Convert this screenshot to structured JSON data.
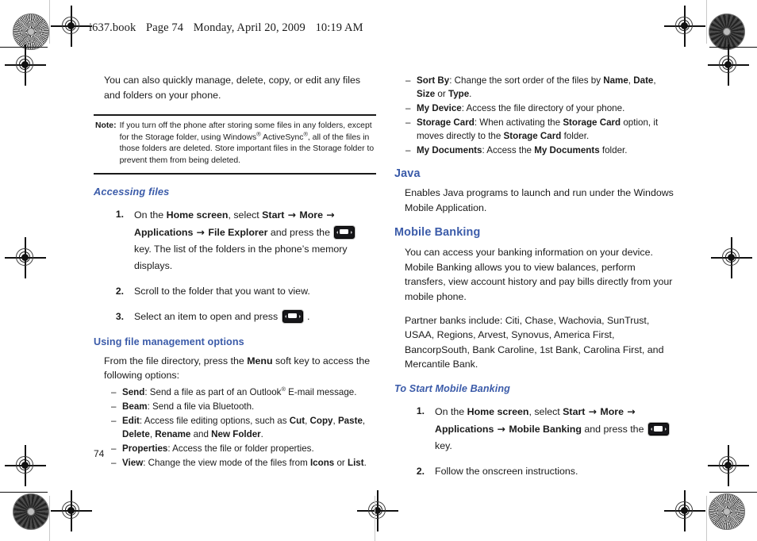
{
  "document": {
    "running_header": [
      "i637.book",
      "Page 74",
      "Monday, April 20, 2009",
      "10:19 AM"
    ],
    "page_number": "74",
    "accent_color": "#3b5ba9",
    "text_color": "#1a1a1a"
  },
  "left_column": {
    "intro": "You can also quickly manage, delete, copy, or edit any files and folders on your phone.",
    "note": {
      "label": "Note:",
      "text_parts": [
        "If you turn off the phone after storing some files in any folders, except for the Storage folder, using Windows",
        "® ",
        "ActiveSync",
        "®",
        ", all of the files in those folders are deleted. Store important files in the Storage folder to prevent them from being deleted."
      ]
    },
    "accessing_files": {
      "heading": "Accessing files",
      "steps": [
        {
          "num": "1.",
          "parts": [
            {
              "t": "On the ",
              "b": false
            },
            {
              "t": "Home screen",
              "b": true
            },
            {
              "t": ", select ",
              "b": false
            },
            {
              "t": "Start",
              "b": true
            },
            {
              "t": " → ",
              "b": false,
              "arrow": true
            },
            {
              "t": "More",
              "b": true
            },
            {
              "t": " → ",
              "b": false,
              "arrow": true
            },
            {
              "t": "Applications",
              "b": true
            },
            {
              "t": " → ",
              "b": false,
              "arrow": true
            },
            {
              "t": "File Explorer",
              "b": true
            },
            {
              "t": " and press the ",
              "b": false
            },
            {
              "t": "[KEY]",
              "b": false,
              "icon": "select-key-icon"
            },
            {
              "t": " key. The list of the folders in the phone’s memory displays.",
              "b": false
            }
          ]
        },
        {
          "num": "2.",
          "parts": [
            {
              "t": "Scroll to the folder that you want to view.",
              "b": false
            }
          ]
        },
        {
          "num": "3.",
          "parts": [
            {
              "t": "Select an item to open and press ",
              "b": false
            },
            {
              "t": "[KEY]",
              "b": false,
              "icon": "select-key-icon"
            },
            {
              "t": " .",
              "b": false
            }
          ]
        }
      ]
    },
    "file_management": {
      "heading": "Using file management options",
      "intro_parts": [
        {
          "t": "From the file directory, press the ",
          "b": false
        },
        {
          "t": "Menu",
          "b": true
        },
        {
          "t": " soft key to access the following options:",
          "b": false
        }
      ],
      "options": [
        {
          "term": "Send",
          "parts": [
            {
              "t": ": Send a file as part of an Outlook",
              "b": false
            },
            {
              "t": "®",
              "b": false,
              "sup": true
            },
            {
              "t": " E-mail message.",
              "b": false
            }
          ]
        },
        {
          "term": "Beam",
          "parts": [
            {
              "t": ": Send a file via Bluetooth.",
              "b": false
            }
          ]
        },
        {
          "term": "Edit",
          "parts": [
            {
              "t": ": Access file editing options, such as ",
              "b": false
            },
            {
              "t": "Cut",
              "b": true
            },
            {
              "t": ", ",
              "b": false
            },
            {
              "t": "Copy",
              "b": true
            },
            {
              "t": ", ",
              "b": false
            },
            {
              "t": "Paste",
              "b": true
            },
            {
              "t": ", ",
              "b": false
            },
            {
              "t": "Delete",
              "b": true
            },
            {
              "t": ", ",
              "b": false
            },
            {
              "t": "Rename",
              "b": true
            },
            {
              "t": " and ",
              "b": false
            },
            {
              "t": "New Folder",
              "b": true
            },
            {
              "t": ".",
              "b": false
            }
          ]
        },
        {
          "term": "Properties",
          "parts": [
            {
              "t": ": Access the file or folder properties.",
              "b": false
            }
          ]
        },
        {
          "term": "View",
          "parts": [
            {
              "t": ": Change the view mode of the files from ",
              "b": false
            },
            {
              "t": "Icons",
              "b": true
            },
            {
              "t": " or ",
              "b": false
            },
            {
              "t": "List",
              "b": true
            },
            {
              "t": ".",
              "b": false
            }
          ]
        }
      ]
    }
  },
  "right_column": {
    "options_continued": [
      {
        "term": "Sort By",
        "parts": [
          {
            "t": ": Change the sort order of the files by ",
            "b": false
          },
          {
            "t": "Name",
            "b": true
          },
          {
            "t": ", ",
            "b": false
          },
          {
            "t": "Date",
            "b": true
          },
          {
            "t": ", ",
            "b": false
          },
          {
            "t": "Size",
            "b": true
          },
          {
            "t": " or ",
            "b": false
          },
          {
            "t": "Type",
            "b": true
          },
          {
            "t": ".",
            "b": false
          }
        ]
      },
      {
        "term": "My Device",
        "parts": [
          {
            "t": ": Access the file directory of your phone.",
            "b": false
          }
        ]
      },
      {
        "term": "Storage Card",
        "parts": [
          {
            "t": ": When activating the ",
            "b": false
          },
          {
            "t": "Storage Card",
            "b": true
          },
          {
            "t": " option, it moves directly to the ",
            "b": false
          },
          {
            "t": "Storage Card",
            "b": true
          },
          {
            "t": " folder.",
            "b": false
          }
        ]
      },
      {
        "term": "My Documents",
        "parts": [
          {
            "t": ": Access the ",
            "b": false
          },
          {
            "t": "My Documents",
            "b": true
          },
          {
            "t": " folder.",
            "b": false
          }
        ]
      }
    ],
    "java": {
      "heading": "Java",
      "body": "Enables Java programs to launch and run under the Windows Mobile Application."
    },
    "mobile_banking": {
      "heading": "Mobile Banking",
      "paragraph1": "You can access your banking information on your device. Mobile Banking allows you to view balances, perform transfers, view account history and pay bills directly from your mobile phone.",
      "paragraph2": "Partner banks include: Citi, Chase, Wachovia, SunTrust, USAA, Regions, Arvest, Synovus, America First, BancorpSouth, Bank Caroline, 1st Bank, Carolina First, and Mercantile Bank.",
      "subheading": "To Start Mobile Banking",
      "steps": [
        {
          "num": "1.",
          "parts": [
            {
              "t": "On the ",
              "b": false
            },
            {
              "t": "Home screen",
              "b": true
            },
            {
              "t": ", select ",
              "b": false
            },
            {
              "t": "Start",
              "b": true
            },
            {
              "t": " → ",
              "b": false,
              "arrow": true
            },
            {
              "t": "More",
              "b": true
            },
            {
              "t": " → ",
              "b": false,
              "arrow": true
            },
            {
              "t": "Applications",
              "b": true
            },
            {
              "t": " → ",
              "b": false,
              "arrow": true
            },
            {
              "t": "Mobile Banking",
              "b": true
            },
            {
              "t": " and press the ",
              "b": false
            },
            {
              "t": "[KEY]",
              "b": false,
              "icon": "select-key-icon"
            },
            {
              "t": " key.",
              "b": false
            }
          ]
        },
        {
          "num": "2.",
          "parts": [
            {
              "t": "Follow the onscreen instructions.",
              "b": false
            }
          ]
        }
      ]
    }
  }
}
